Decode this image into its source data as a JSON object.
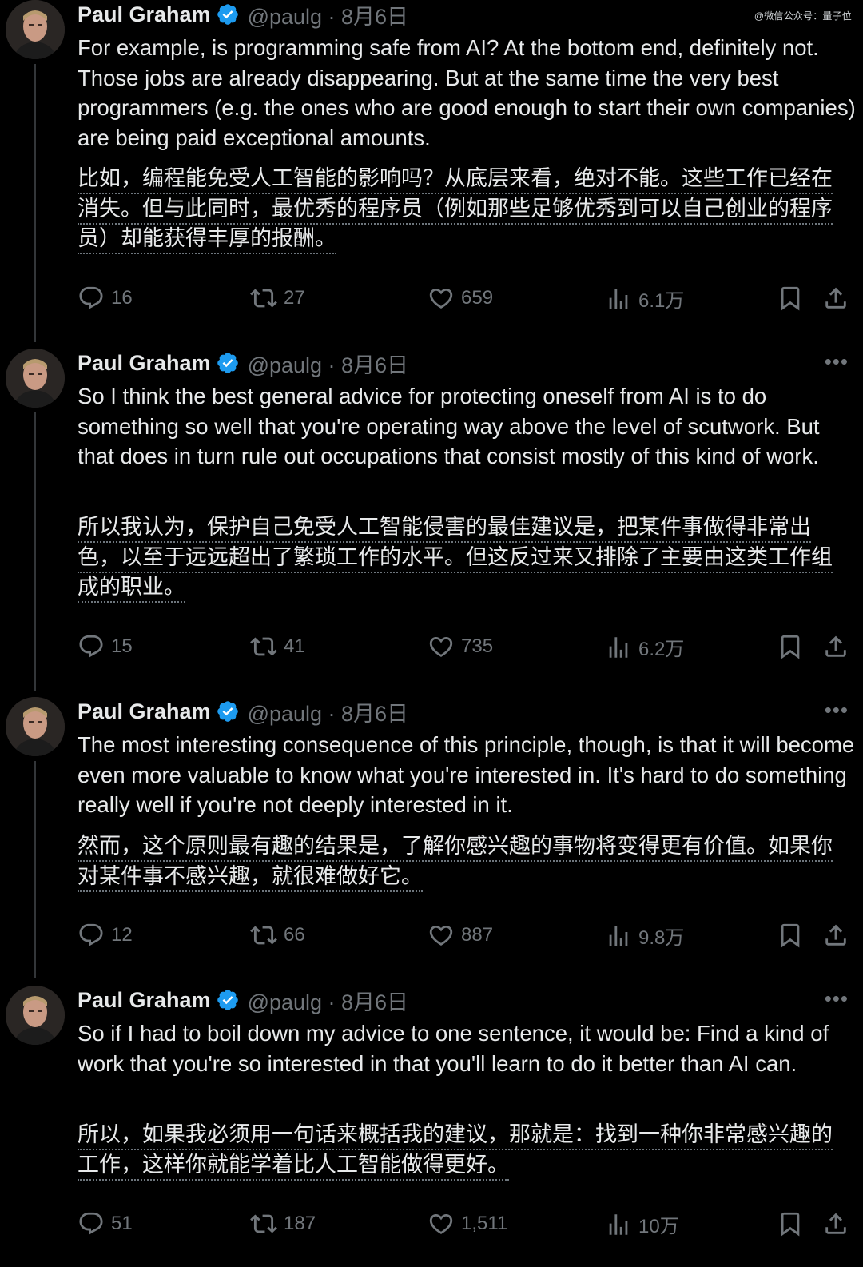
{
  "watermark": "@微信公众号：量子位",
  "tweets": [
    {
      "author_name": "Paul Graham",
      "handle_date": "@paulg · 8月6日",
      "text_en": "For example, is programming safe from AI? At the bottom end, definitely not. Those jobs are already disappearing. But at the same time the very best programmers (e.g. the ones who are good enough to start their own companies) are being paid exceptional amounts.",
      "text_zh": "比如，编程能免受人工智能的影响吗？从底层来看，绝对不能。这些工作已经在消失。但与此同时，最优秀的程序员（例如那些足够优秀到可以自己创业的程序员）却能获得丰厚的报酬。",
      "replies": "16",
      "retweets": "27",
      "likes": "659",
      "views": "6.1万"
    },
    {
      "author_name": "Paul Graham",
      "handle_date": "@paulg · 8月6日",
      "text_en": "So I think the best general advice for protecting oneself from AI is to do something so well that you're operating way above the level of scutwork. But that does in turn rule out occupations that consist mostly of this kind of work.",
      "text_zh": "所以我认为，保护自己免受人工智能侵害的最佳建议是，把某件事做得非常出色，以至于远远超出了繁琐工作的水平。但这反过来又排除了主要由这类工作组成的职业。",
      "replies": "15",
      "retweets": "41",
      "likes": "735",
      "views": "6.2万"
    },
    {
      "author_name": "Paul Graham",
      "handle_date": "@paulg · 8月6日",
      "text_en": "The most interesting consequence of this principle, though, is that it will become even more valuable to know what you're interested in. It's hard to do something really well if you're not deeply interested in it.",
      "text_zh": "然而，这个原则最有趣的结果是，了解你感兴趣的事物将变得更有价值。如果你对某件事不感兴趣，就很难做好它。",
      "replies": "12",
      "retweets": "66",
      "likes": "887",
      "views": "9.8万"
    },
    {
      "author_name": "Paul Graham",
      "handle_date": "@paulg · 8月6日",
      "text_en": "So if I had to boil down my advice to one sentence, it would be: Find a kind of work that you're so interested in that you'll learn to do it better than AI can.",
      "text_zh": "所以，如果我必须用一句话来概括我的建议，那就是：找到一种你非常感兴趣的工作，这样你就能学着比人工智能做得更好。",
      "replies": "51",
      "retweets": "187",
      "likes": "1,511",
      "views": "10万"
    }
  ],
  "icons": {
    "verified": "verified-badge-icon",
    "reply": "reply-icon",
    "retweet": "retweet-icon",
    "like": "heart-icon",
    "views": "views-icon",
    "bookmark": "bookmark-icon",
    "share": "share-icon",
    "more": "more-icon"
  },
  "colors": {
    "background": "#000000",
    "text": "#e7e9ea",
    "muted": "#71767b",
    "verified": "#1d9bf0"
  }
}
